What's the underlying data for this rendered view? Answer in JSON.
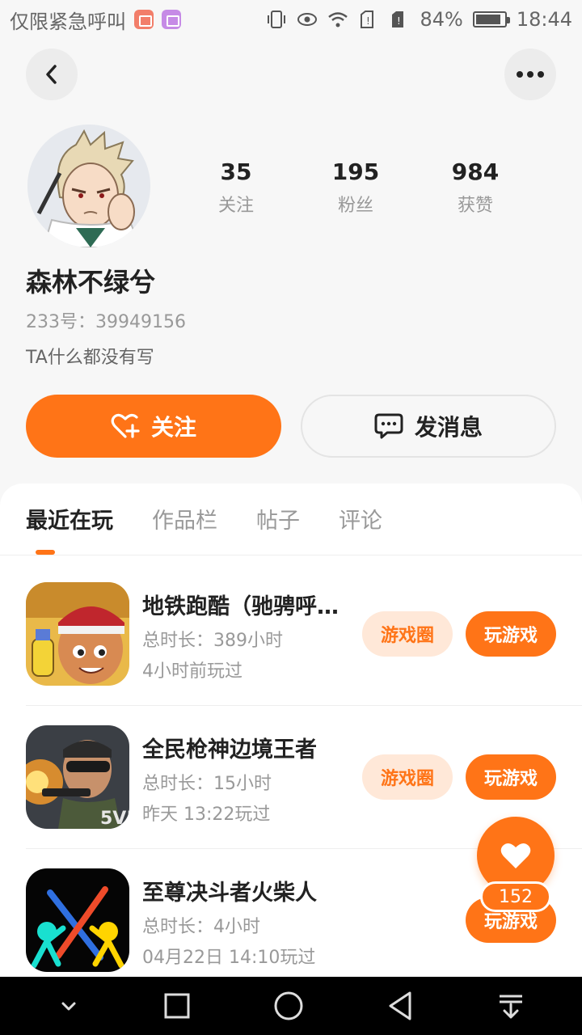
{
  "status_bar": {
    "carrier_text": "仅限紧急呼叫",
    "battery_percent": "84%",
    "time": "18:44"
  },
  "nav": {
    "back_icon": "chevron-left-icon",
    "more_icon": "ellipsis-icon"
  },
  "profile": {
    "stats": [
      {
        "value": "35",
        "label": "关注"
      },
      {
        "value": "195",
        "label": "粉丝"
      },
      {
        "value": "984",
        "label": "获赞"
      }
    ],
    "username": "森林不绿兮",
    "user_id": "233号：39949156",
    "bio": "TA什么都没有写"
  },
  "actions": {
    "follow_label": "关注",
    "message_label": "发消息"
  },
  "tabs": [
    {
      "label": "最近在玩",
      "active": true
    },
    {
      "label": "作品栏",
      "active": false
    },
    {
      "label": "帖子",
      "active": false
    },
    {
      "label": "评论",
      "active": false
    }
  ],
  "games": [
    {
      "name": "地铁跑酷（驰骋呼…",
      "duration": "总时长：389小时",
      "last_played": "4小时前玩过",
      "circle_label": "游戏圈",
      "play_label": "玩游戏"
    },
    {
      "name": "全民枪神边境王者",
      "duration": "总时长：15小时",
      "last_played": "昨天 13:22玩过",
      "circle_label": "游戏圈",
      "play_label": "玩游戏"
    },
    {
      "name": "至尊决斗者火柴人",
      "duration": "总时长：4小时",
      "last_played": "04月22日 14:10玩过",
      "play_label": "玩游戏"
    }
  ],
  "like_fab": {
    "count": "152",
    "icon": "heart-icon"
  },
  "colors": {
    "accent": "#ff7417",
    "accent_light": "#ffe8d8"
  }
}
